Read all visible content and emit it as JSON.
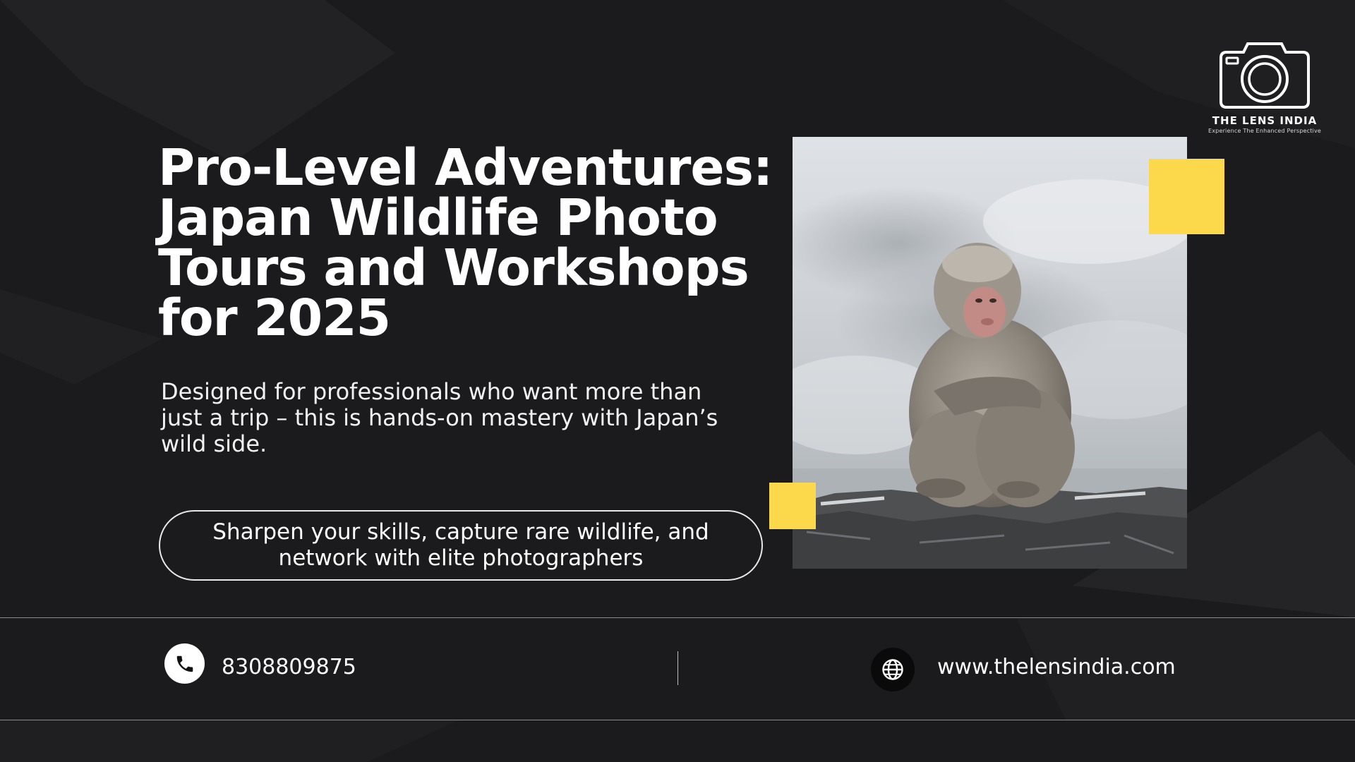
{
  "brand": {
    "name": "THE LENS INDIA",
    "tagline": "Experience The Enhanced Perspective",
    "logo_icon": "camera-icon"
  },
  "hero": {
    "headline_lines": [
      "Pro-Level Adventures:",
      "Japan Wildlife Photo",
      "Tours and Workshops",
      "for 2025"
    ],
    "subtext_lines": [
      "Designed for professionals who want more than",
      "just a trip – this is hands-on mastery with Japan’s",
      "wild side."
    ],
    "pill_lines": [
      "Sharpen your skills, capture rare wildlife, and",
      "network with elite photographers"
    ],
    "photo_subject": "snow monkey on rock in misty hot spring"
  },
  "contact": {
    "phone": "8308809875",
    "phone_icon": "phone-icon",
    "website": "www.thelensindia.com",
    "website_icon": "globe-icon"
  },
  "colors": {
    "background": "#1b1b1d",
    "accent": "#fcd94b",
    "text": "#ffffff"
  }
}
